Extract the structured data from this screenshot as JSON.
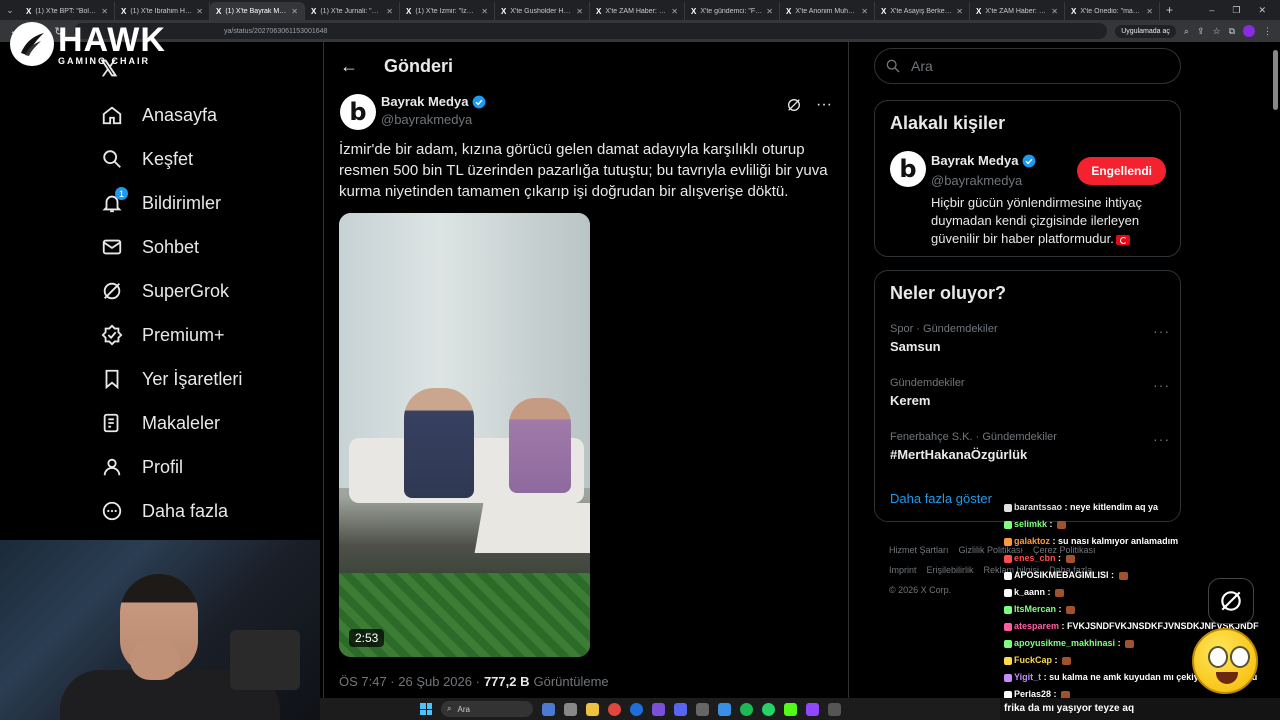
{
  "browser": {
    "tabs": [
      {
        "title": "(1) X'te BPT: \"Bolu'da",
        "active": false
      },
      {
        "title": "(1) X'te İbrahim Hasko",
        "active": false
      },
      {
        "title": "(1) X'te Bayrak Medya",
        "active": true
      },
      {
        "title": "(1) X'te Jurnali: \"Bir kad",
        "active": false
      },
      {
        "title": "(1) X'te İzmir: \"İzmir'e",
        "active": false
      },
      {
        "title": "X'te Gusholder Haber",
        "active": false
      },
      {
        "title": "X'te ZAM Haber: \"Bir c",
        "active": false
      },
      {
        "title": "X'te gündemci: \"Fenb",
        "active": false
      },
      {
        "title": "X'te Anonim Muhabir",
        "active": false
      },
      {
        "title": "X'te Asayiş Berkemal",
        "active": false
      },
      {
        "title": "X'te ZAM Haber: \"Bir c",
        "active": false
      },
      {
        "title": "X'te Onedio: \"manifest",
        "active": false
      }
    ],
    "url": "ya/status/2027063061153001648",
    "open_in_app": "Uygulamada aç"
  },
  "overlay_logo": {
    "title": "HAWK",
    "subtitle": "GAMING CHAIR"
  },
  "sidebar": {
    "items": [
      {
        "label": "Anasayfa",
        "icon": "home-icon"
      },
      {
        "label": "Keşfet",
        "icon": "search-icon"
      },
      {
        "label": "Bildirimler",
        "icon": "bell-icon",
        "badge": "1"
      },
      {
        "label": "Sohbet",
        "icon": "mail-icon"
      },
      {
        "label": "SuperGrok",
        "icon": "grok-icon"
      },
      {
        "label": "Premium+",
        "icon": "premium-icon"
      },
      {
        "label": "Yer İşaretleri",
        "icon": "bookmark-icon"
      },
      {
        "label": "Makaleler",
        "icon": "article-icon"
      },
      {
        "label": "Profil",
        "icon": "profile-icon"
      },
      {
        "label": "Daha fazla",
        "icon": "more-icon"
      }
    ]
  },
  "post": {
    "header_title": "Gönderi",
    "author_name": "Bayrak Medya",
    "author_handle": "@bayrakmedya",
    "text": "İzmir'de bir adam, kızına görücü gelen damat adayıyla karşılıklı oturup resmen 500 bin TL üzerinden pazarlığa tutuştu; bu tavrıyla evliliği bir yuva kurma niyetinden tamamen çıkarıp işi doğrudan bir alışverişe döktü.",
    "video_duration": "2:53",
    "timestamp": "ÖS 7:47 · 26 Şub 2026 ·",
    "views": "777,2 B",
    "views_label": "Görüntüleme"
  },
  "right": {
    "search_placeholder": "Ara",
    "related_title": "Alakalı kişiler",
    "related": {
      "name": "Bayrak Medya",
      "handle": "@bayrakmedya",
      "button": "Engellendi",
      "bio": "Hiçbir gücün yönlendirmesine ihtiyaç duymadan kendi çizgisinde ilerleyen güvenilir bir haber platformudur."
    },
    "trends_title": "Neler oluyor?",
    "trends": [
      {
        "category": "Spor · Gündemdekiler",
        "name": "Samsun"
      },
      {
        "category": "Gündemdekiler",
        "name": "Kerem"
      },
      {
        "category": "Fenerbahçe S.K. · Gündemdekiler",
        "name": "#MertHakanaÖzgürlük"
      }
    ],
    "show_more": "Daha fazla göster",
    "footer": {
      "line1": [
        "Hizmet Şartları",
        "Gizlilik Politikası",
        "Çerez Politikası"
      ],
      "line2": [
        "Imprint",
        "Erişilebilirlik",
        "Reklam bilgisi",
        "Daha fazla ..."
      ],
      "copyright": "© 2026 X Corp."
    }
  },
  "chat": {
    "messages": [
      {
        "user": "barantssao",
        "text": "neye kitlendim aq ya",
        "color": "#e0e0e0"
      },
      {
        "user": "selimkk",
        "text": "",
        "color": "#7fff7f"
      },
      {
        "user": "galaktoz",
        "text": "su nası kalmıyor anlamadım",
        "color": "#ff9a3c"
      },
      {
        "user": "enes_cbn",
        "text": "",
        "color": "#ff4d4d"
      },
      {
        "user": "APOSIKMEBAGIMLISI",
        "text": "",
        "color": "#ffffff"
      },
      {
        "user": "k_aann",
        "text": "",
        "color": "#ffffff"
      },
      {
        "user": "ItsMercan",
        "text": "",
        "color": "#7cff7c"
      },
      {
        "user": "atesparem",
        "text": "FVKJSNDFVKJNSDKFJVNSDKJNFVSKJNDF",
        "color": "#ff5fa2"
      },
      {
        "user": "apoyusikme_makhinasi",
        "text": "",
        "color": "#7fff7f"
      },
      {
        "user": "FuckCap",
        "text": "",
        "color": "#ffd84d"
      },
      {
        "user": "Yigit_t",
        "text": "su kalma ne amk kuyudan mı çekiyorsunuz suyu",
        "color": "#c58cff"
      },
      {
        "user": "Perlas28",
        "text": "",
        "color": "#ffffff"
      }
    ],
    "input": "frika da mı yaşıyor teyze aq"
  },
  "taskbar": {
    "search_label": "Ara"
  }
}
